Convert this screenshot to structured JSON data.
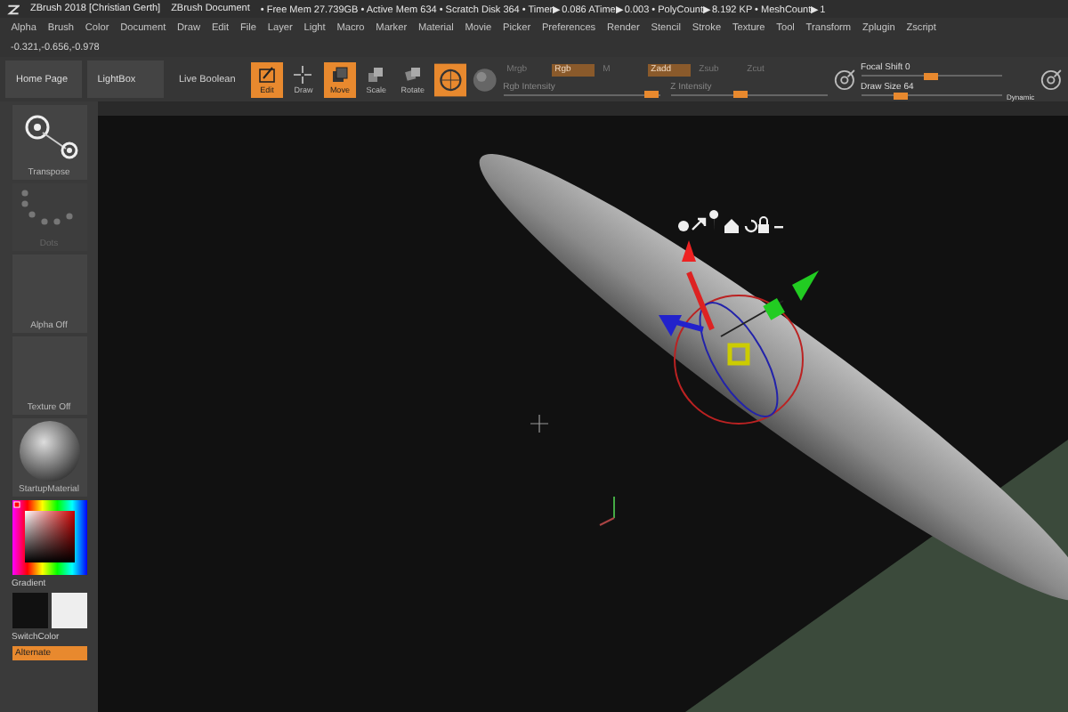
{
  "title_bar": {
    "app": "ZBrush 2018 [Christian Gerth]",
    "document": "ZBrush Document",
    "stats": "• Free Mem 27.739GB • Active Mem 634 • Scratch Disk 364 • Timer▶0.086 ATime▶0.003 • PolyCount▶8.192 KP • MeshCount▶1"
  },
  "menu": [
    "Alpha",
    "Brush",
    "Color",
    "Document",
    "Draw",
    "Edit",
    "File",
    "Layer",
    "Light",
    "Macro",
    "Marker",
    "Material",
    "Movie",
    "Picker",
    "Preferences",
    "Render",
    "Stencil",
    "Stroke",
    "Texture",
    "Tool",
    "Transform",
    "Zplugin",
    "Zscript"
  ],
  "coordinates": "-0.321,-0.656,-0.978",
  "toolbar": {
    "buttons": [
      "Home Page",
      "LightBox"
    ],
    "live_boolean": "Live Boolean",
    "tools": [
      {
        "label": "Edit",
        "kind": "edit",
        "selected": true
      },
      {
        "label": "Draw",
        "kind": "draw",
        "selected": false
      },
      {
        "label": "Move",
        "kind": "move",
        "selected": true
      },
      {
        "label": "Scale",
        "kind": "scale",
        "selected": false
      },
      {
        "label": "Rotate",
        "kind": "rotate",
        "selected": false
      }
    ],
    "modes": [
      {
        "label": "Mrgb",
        "selected": false
      },
      {
        "label": "Rgb",
        "selected": true
      },
      {
        "label": "M",
        "selected": false
      },
      {
        "label": "Zadd",
        "selected": true
      },
      {
        "label": "Zsub",
        "selected": false
      },
      {
        "label": "Zcut",
        "selected": false
      }
    ],
    "intensities": [
      {
        "label": "Rgb Intensity",
        "level": 0.95
      },
      {
        "label": "Z Intensity",
        "level": 0.45
      }
    ],
    "focal_shift": {
      "label": "Focal Shift 0",
      "level": 0.5
    },
    "draw_size": {
      "label": "Draw Size 64",
      "level": 0.28
    },
    "dynamic": "Dynamic"
  },
  "left_panel": {
    "transpose": "Transpose",
    "stroke": "Dots",
    "alpha": "Alpha Off",
    "texture": "Texture Off",
    "material": "StartupMaterial",
    "gradient": "Gradient",
    "switch_color": "SwitchColor",
    "alternate": "Alternate"
  }
}
